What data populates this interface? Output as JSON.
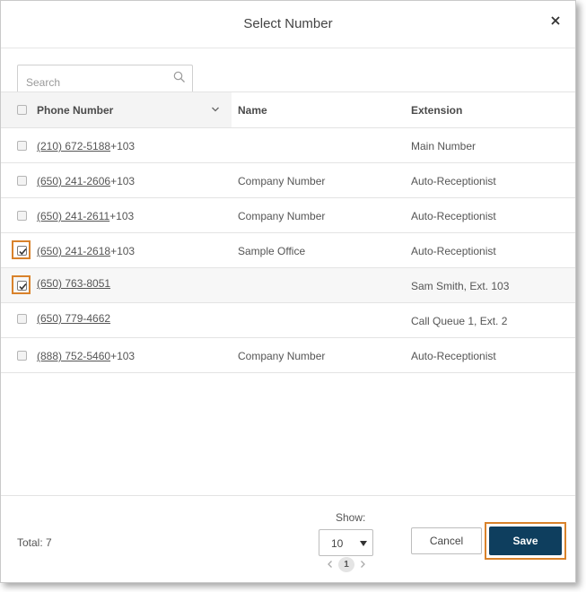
{
  "dialog": {
    "title": "Select Number",
    "close_icon": "close-icon"
  },
  "search": {
    "placeholder": "Search",
    "value": "",
    "icon": "search-icon"
  },
  "table": {
    "columns": {
      "phone": "Phone Number",
      "name": "Name",
      "extension": "Extension"
    },
    "sort_icon": "chevron-down-icon",
    "rows": [
      {
        "phone": "(210) 672-5188",
        "suffix": "+103",
        "name": "",
        "extension": "Main Number",
        "checked": false
      },
      {
        "phone": "(650) 241-2606",
        "suffix": "+103",
        "name": "Company Number",
        "extension": "Auto-Receptionist",
        "checked": false
      },
      {
        "phone": "(650) 241-2611",
        "suffix": "+103",
        "name": "Company Number",
        "extension": "Auto-Receptionist",
        "checked": false
      },
      {
        "phone": "(650) 241-2618",
        "suffix": "+103",
        "name": "Sample Office",
        "extension": "Auto-Receptionist",
        "checked": true
      },
      {
        "phone": "(650) 763-8051",
        "suffix": "",
        "name": "",
        "extension": "Sam Smith, Ext. 103",
        "checked": true
      },
      {
        "phone": "(650) 779-4662",
        "suffix": "",
        "name": "",
        "extension": "Call Queue 1, Ext. 2",
        "checked": false
      },
      {
        "phone": "(888) 752-5460",
        "suffix": "+103",
        "name": "Company Number",
        "extension": "Auto-Receptionist",
        "checked": false
      }
    ]
  },
  "footer": {
    "total": "Total: 7",
    "show_label": "Show:",
    "page_size": "10",
    "current_page": "1",
    "cancel_label": "Cancel",
    "save_label": "Save"
  },
  "colors": {
    "save_button": "#0e3e5e",
    "highlight": "#d9822b"
  }
}
